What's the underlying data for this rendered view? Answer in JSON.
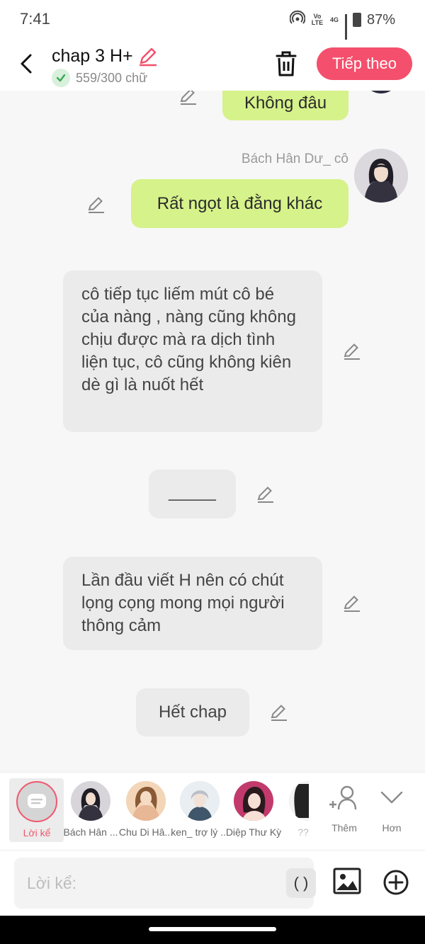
{
  "status": {
    "time": "7:41",
    "net1": "Vo LTE",
    "net2": "4G",
    "battery": "87%"
  },
  "header": {
    "title": "chap 3 H+",
    "word_count": "559/300 chữ",
    "next_label": "Tiếp theo"
  },
  "messages": {
    "m0": {
      "text": "Không đâu"
    },
    "m1": {
      "sender": "Bách Hân Dư_ cô",
      "text": "Rất ngọt là đằng khác"
    },
    "m2": {
      "text": "cô tiếp tục liếm mút cô bé của nàng , nàng cũng không chịu được mà ra dịch tình liện tục, cô cũng không kiên dè gì là nuốt hết"
    },
    "m3": {
      "text": "_____"
    },
    "m4": {
      "text": "Lần đầu viết H nên có chút lọng cọng mong mọi người thông cảm"
    },
    "m5": {
      "text": "Hết chap"
    }
  },
  "characters": {
    "narrator": "Lời kể",
    "c1": "Bách Hân ...",
    "c2": "Chu Di Hâ...",
    "c3": "ken_ trợ lý ...",
    "c4": "Diệp Thư Kỳ",
    "c5": "??",
    "add": "Thêm",
    "more": "Hơn"
  },
  "input": {
    "placeholder": "Lời kể:",
    "paren": "( )"
  }
}
